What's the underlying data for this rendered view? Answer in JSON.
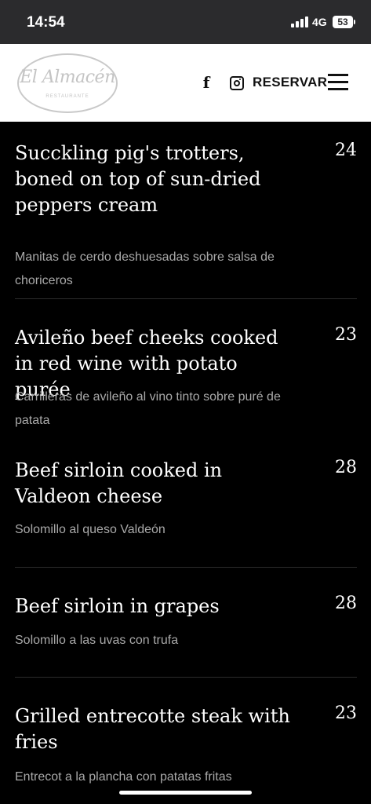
{
  "status_bar": {
    "time": "14:54",
    "network": "4G",
    "battery": "53"
  },
  "header": {
    "logo_text": "El Almacén",
    "logo_subtitle": "RESTAURANTE",
    "facebook_icon": "facebook-icon",
    "instagram_icon": "instagram-icon",
    "reserve_label": "RESERVAR",
    "menu_icon": "hamburger-menu-icon"
  },
  "dishes": [
    {
      "name": "Succkling pig's trotters, boned on top of sun-dried peppers cream",
      "price": "24",
      "description": "Manitas de cerdo deshuesadas sobre salsa de choriceros"
    },
    {
      "name": "Avileño beef cheeks cooked in red wine with potato purée",
      "price": "23",
      "description": "Carrilleras de avileño al vino tinto sobre puré de patata"
    },
    {
      "name": "Beef sirloin cooked in Valdeon cheese",
      "price": "28",
      "description": "Solomillo al queso Valdeón"
    },
    {
      "name": "Beef sirloin in grapes",
      "price": "28",
      "description": "Solomillo a las uvas con trufa"
    },
    {
      "name": "Grilled entrecotte steak with fries",
      "price": "23",
      "description": "Entrecot a la plancha con patatas fritas"
    }
  ]
}
